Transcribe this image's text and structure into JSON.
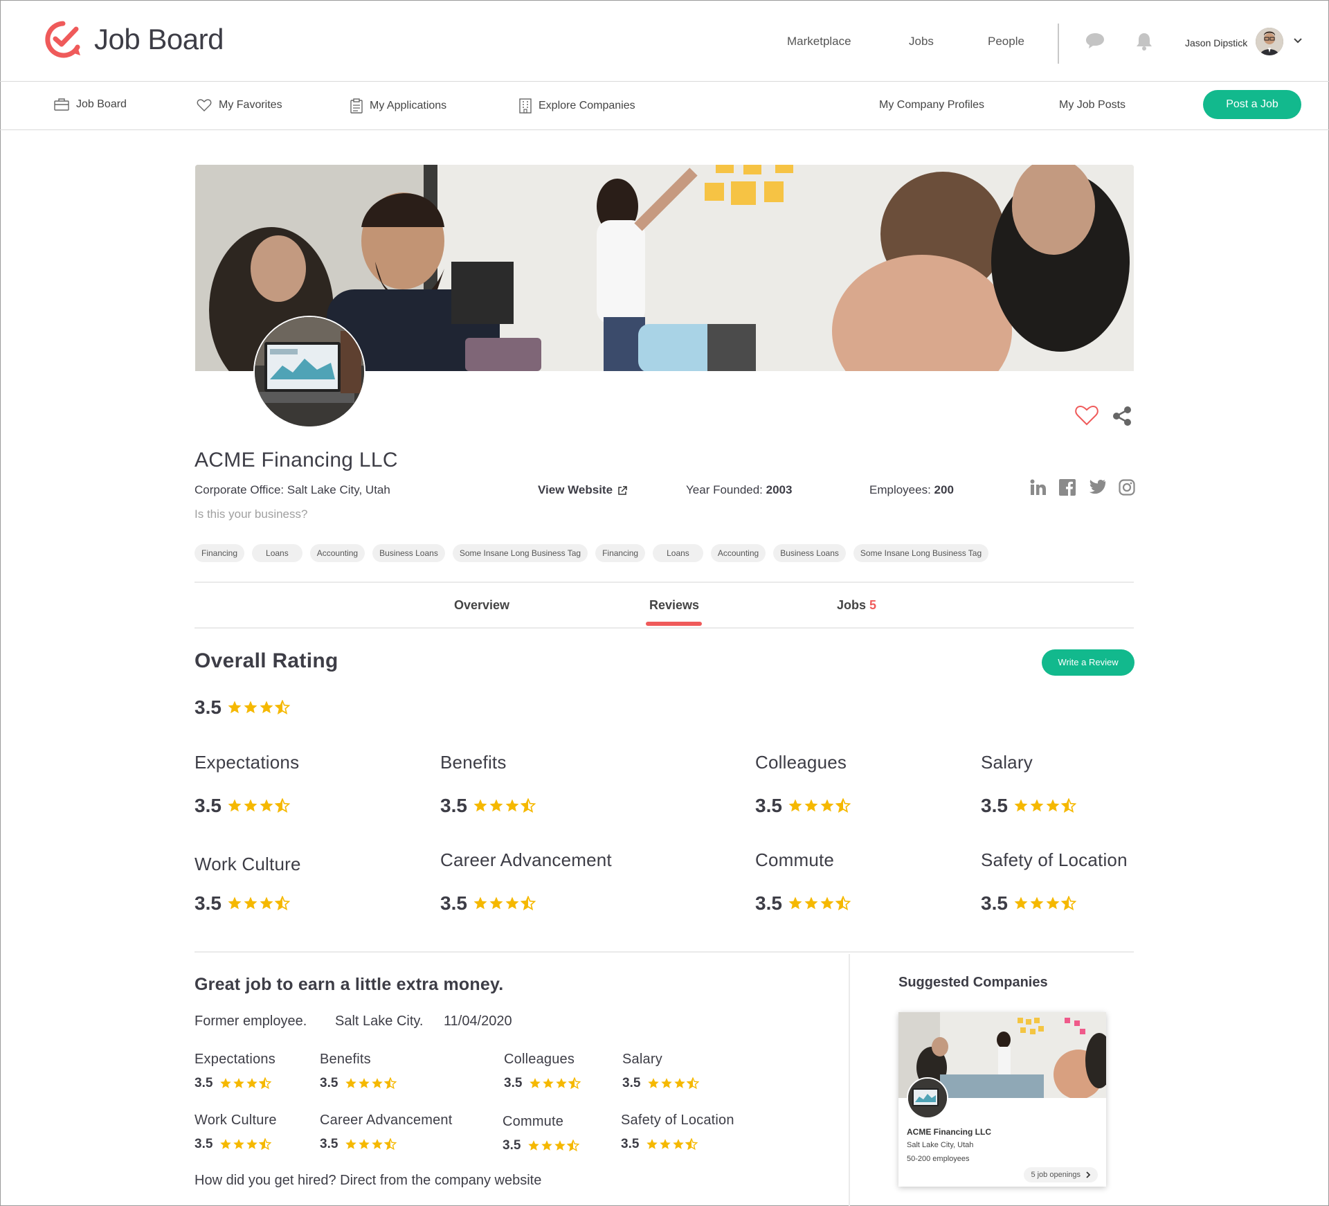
{
  "header": {
    "logo_text": "Job Board",
    "nav": [
      "Marketplace",
      "Jobs",
      "People"
    ],
    "user_name": "Jason Dipstick"
  },
  "subnav": {
    "items": [
      "Job Board",
      "My Favorites",
      "My Applications",
      "Explore Companies"
    ],
    "right_items": [
      "My Company Profiles",
      "My Job Posts"
    ],
    "post_button": "Post a Job"
  },
  "company": {
    "name": "ACME Financing LLC",
    "office_label": "Corporate Office: ",
    "office_value": "Salt Lake City, Utah",
    "website": "View Website",
    "founded_label": "Year Founded: ",
    "founded_value": "2003",
    "employees_label": "Employees: ",
    "employees_value": "200",
    "claim": "Is this your business?",
    "tags": [
      "Financing",
      "Loans",
      "Accounting",
      "Business Loans",
      "Some Insane Long Business Tag",
      "Financing",
      "Loans",
      "Accounting",
      "Business Loans",
      "Some Insane Long Business Tag"
    ],
    "social": [
      "linkedin-icon",
      "facebook-icon",
      "twitter-icon",
      "instagram-icon"
    ]
  },
  "tabs": {
    "overview": "Overview",
    "reviews": "Reviews",
    "jobs": "Jobs",
    "jobs_count": "5",
    "active": "Reviews"
  },
  "overall": {
    "title": "Overall Rating",
    "write_button": "Write a Review",
    "value": "3.5",
    "stars": 3.5,
    "categories": [
      {
        "label": "Expectations",
        "value": "3.5",
        "stars": 3.5
      },
      {
        "label": "Benefits",
        "value": "3.5",
        "stars": 3.5
      },
      {
        "label": "Colleagues",
        "value": "3.5",
        "stars": 3.5
      },
      {
        "label": "Salary",
        "value": "3.5",
        "stars": 3.5
      },
      {
        "label": "Work Culture",
        "value": "3.5",
        "stars": 3.5
      },
      {
        "label": "Career Advancement",
        "value": "3.5",
        "stars": 3.5
      },
      {
        "label": "Commute",
        "value": "3.5",
        "stars": 3.5
      },
      {
        "label": "Safety of Location",
        "value": "3.5",
        "stars": 3.5
      }
    ]
  },
  "review": {
    "title": "Great job to earn a little extra money.",
    "status": "Former employee.",
    "location": "Salt Lake City.",
    "date": "11/04/2020",
    "categories": [
      {
        "label": "Expectations",
        "value": "3.5",
        "stars": 3.5
      },
      {
        "label": "Benefits",
        "value": "3.5",
        "stars": 3.5
      },
      {
        "label": "Colleagues",
        "value": "3.5",
        "stars": 3.5
      },
      {
        "label": "Salary",
        "value": "3.5",
        "stars": 3.5
      },
      {
        "label": "Work Culture",
        "value": "3.5",
        "stars": 3.5
      },
      {
        "label": "Career Advancement",
        "value": "3.5",
        "stars": 3.5
      },
      {
        "label": "Commute",
        "value": "3.5",
        "stars": 3.5
      },
      {
        "label": "Safety of Location",
        "value": "3.5",
        "stars": 3.5
      }
    ],
    "hired_question": "How did you get hired? Direct from the company website"
  },
  "suggested": {
    "title": "Suggested Companies",
    "cards": [
      {
        "name": "ACME Financing LLC",
        "location": "Salt Lake City, Utah",
        "employees": "50-200 employees",
        "openings": "5 job openings"
      }
    ]
  },
  "colors": {
    "accent_green": "#12b98d",
    "accent_red": "#ef5a5a",
    "star": "#f5b800",
    "text": "#3d3d46"
  }
}
